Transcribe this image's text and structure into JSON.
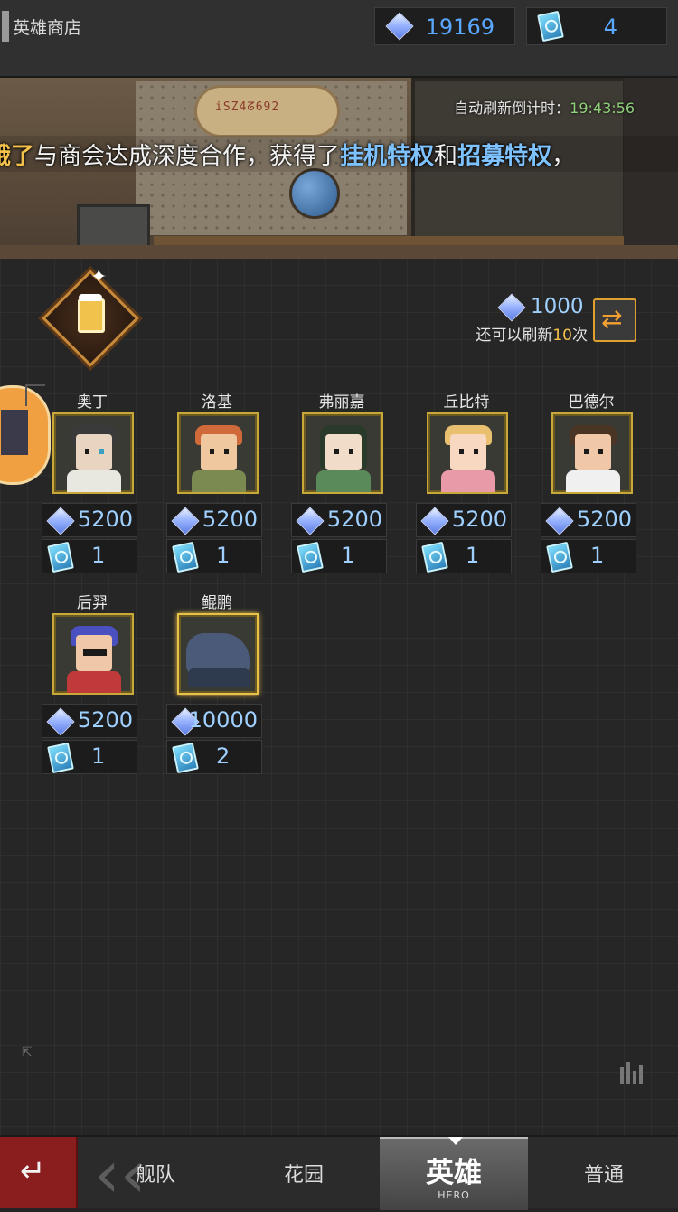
{
  "header": {
    "title": "英雄商店",
    "diamonds": "19169",
    "tickets": "4"
  },
  "banner": {
    "countdown_label": "自动刷新倒计时：",
    "countdown_time": "19:43:56",
    "marquee": {
      "part1": "饿了",
      "part2": "与商会达成深度合作，获得了",
      "part3": "挂机特权",
      "part4": "和",
      "part5": "招募特权",
      "part6": "，"
    },
    "sign_text": "iSZ4ᘔ692"
  },
  "refresh": {
    "cost": "1000",
    "remaining_prefix": "还可以刷新",
    "remaining_count": "10",
    "remaining_suffix": "次"
  },
  "heroes": [
    {
      "name": "奥丁",
      "price": "5200",
      "tickets": "1"
    },
    {
      "name": "洛基",
      "price": "5200",
      "tickets": "1"
    },
    {
      "name": "弗丽嘉",
      "price": "5200",
      "tickets": "1"
    },
    {
      "name": "丘比特",
      "price": "5200",
      "tickets": "1"
    },
    {
      "name": "巴德尔",
      "price": "5200",
      "tickets": "1"
    },
    {
      "name": "后羿",
      "price": "5200",
      "tickets": "1"
    },
    {
      "name": "鲲鹏",
      "price": "10000",
      "tickets": "2"
    }
  ],
  "nav": {
    "tabs": [
      {
        "label": "舰队"
      },
      {
        "label": "花园"
      },
      {
        "label": "英雄",
        "sub": "HERO"
      },
      {
        "label": "普通"
      }
    ],
    "active": "英雄"
  },
  "colors": {
    "accent_gold": "#c9a83a",
    "diamond_blue": "#9fd0ff",
    "highlight_yellow": "#f4c24a",
    "highlight_blue": "#7ec3ff",
    "back_red": "#8a1e1e"
  },
  "icons": [
    "diamond-icon",
    "ticket-icon",
    "refresh-icon",
    "back-arrow-icon",
    "beer-icon"
  ]
}
